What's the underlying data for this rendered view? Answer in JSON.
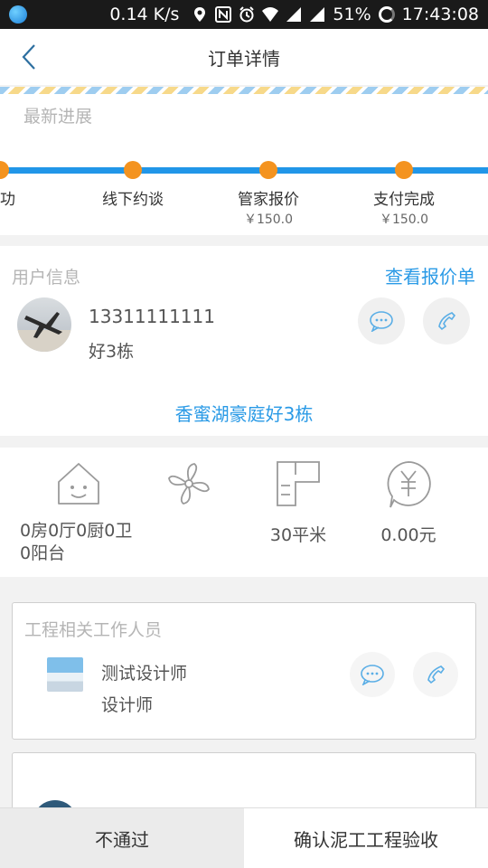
{
  "status_bar": {
    "speed": "0.14 K/s",
    "battery": "51%",
    "time": "17:43:08"
  },
  "header": {
    "title": "订单详情"
  },
  "progress": {
    "label": "最新进展",
    "steps": [
      {
        "label": "成功",
        "price": ""
      },
      {
        "label": "线下约谈",
        "price": ""
      },
      {
        "label": "管家报价",
        "price": "￥150.0"
      },
      {
        "label": "支付完成",
        "price": "￥150.0"
      }
    ]
  },
  "user": {
    "label": "用户信息",
    "view_quote_link": "查看报价单",
    "phone": "13311111111",
    "address": "好3栋",
    "community": "香蜜湖豪庭好3栋"
  },
  "stats": {
    "rooms": "0房0厅0厨0卫0阳台",
    "area": "30平米",
    "price": "0.00元"
  },
  "staff_card": {
    "label": "工程相关工作人员",
    "name": "测试设计师",
    "role": "设计师"
  },
  "actions": {
    "reject": "不通过",
    "confirm": "确认泥工工程验收"
  },
  "colors": {
    "accent": "#2a9ae6",
    "progress_line": "#2196e8",
    "progress_dot": "#f4931f"
  }
}
